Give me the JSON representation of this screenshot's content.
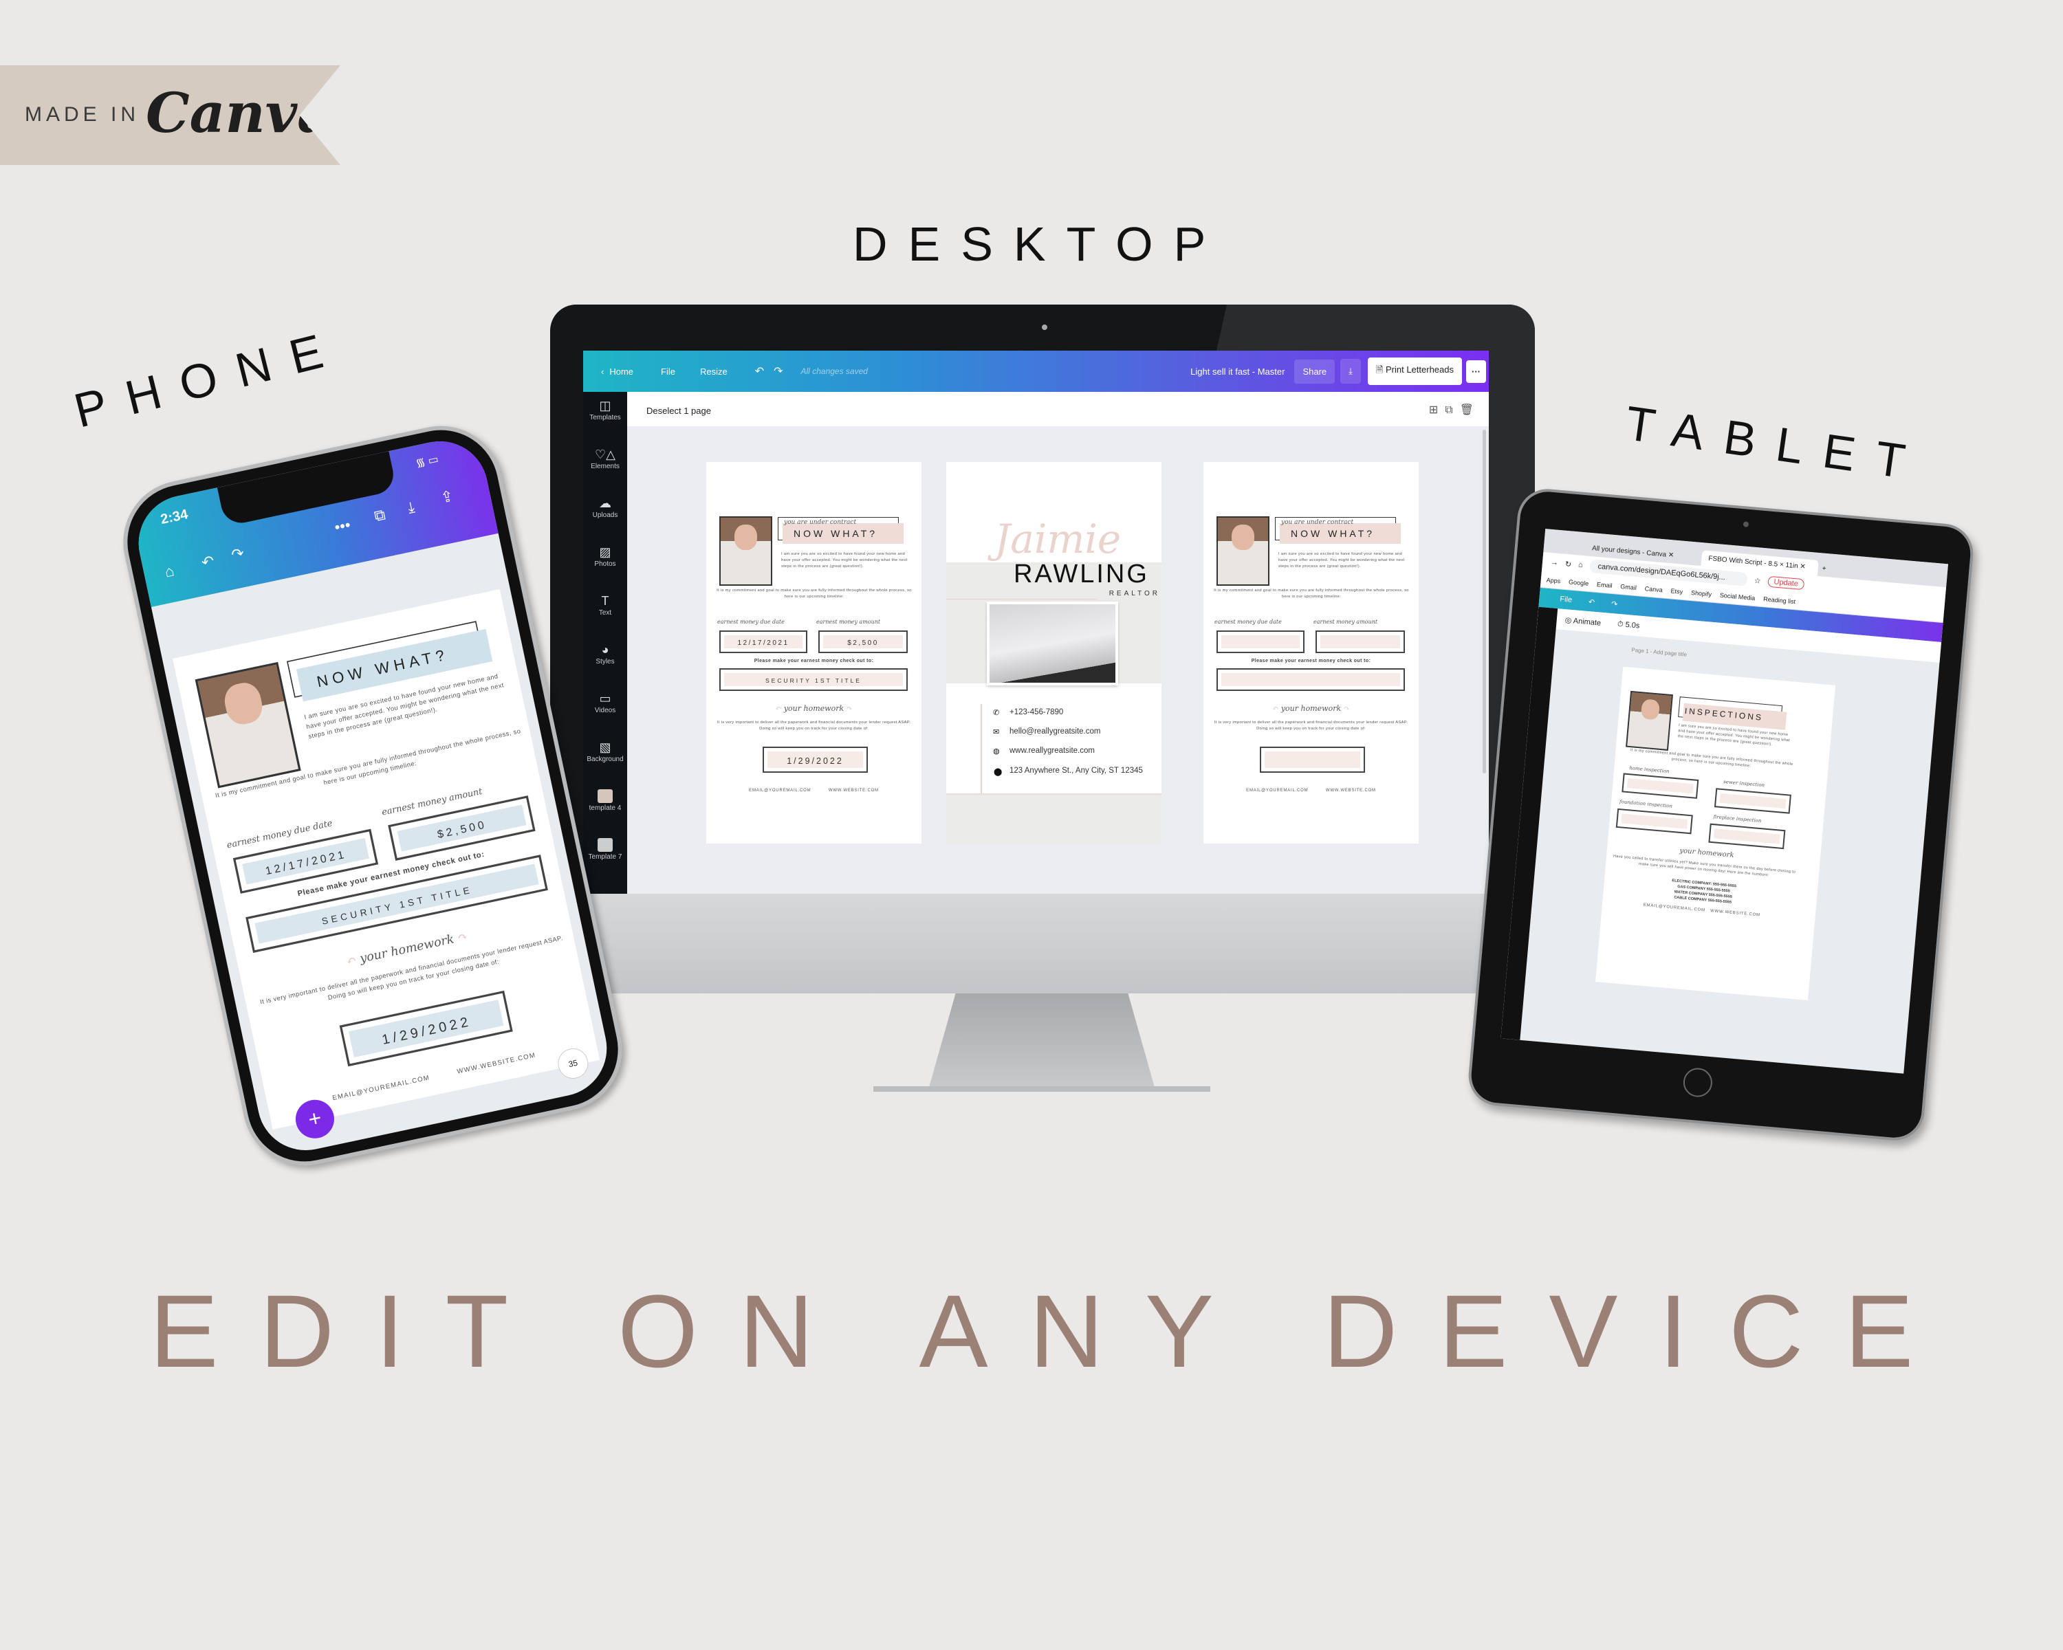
{
  "brand": {
    "made_in": "MADE IN",
    "logo": "Canva"
  },
  "headings": {
    "desktop": "DESKTOP",
    "phone": "PHONE",
    "tablet": "TABLET",
    "tagline": "EDIT ON ANY DEVICE"
  },
  "colors": {
    "accent_start": "#1fb5c6",
    "accent_end": "#7b2ff0",
    "tagline": "#9b8075",
    "blush": "#f0dcd6",
    "fab": "#7d2ae8"
  },
  "desktop": {
    "toolbar": {
      "home": "Home",
      "file": "File",
      "resize": "Resize",
      "status": "All changes saved",
      "doc_title": "Light sell it fast - Master",
      "share": "Share",
      "print": "Print Letterheads",
      "more": "···"
    },
    "sidebar": [
      {
        "label": "Templates",
        "icon": "templates-icon"
      },
      {
        "label": "Elements",
        "icon": "elements-icon"
      },
      {
        "label": "Uploads",
        "icon": "upload-cloud-icon"
      },
      {
        "label": "Photos",
        "icon": "photos-icon"
      },
      {
        "label": "Text",
        "icon": "text-icon"
      },
      {
        "label": "Styles",
        "icon": "palette-icon"
      },
      {
        "label": "Videos",
        "icon": "video-icon"
      },
      {
        "label": "Background",
        "icon": "background-icon"
      },
      {
        "label": "template 4",
        "icon": "template-thumbnail"
      },
      {
        "label": "Template 7",
        "icon": "template-thumbnail"
      }
    ],
    "deselect": "Deselect 1 page"
  },
  "letter": {
    "script_title": "you are under contract",
    "title": "NOW WHAT?",
    "para1": "I am sure you are so excited to have found your new home and have your offer accepted.  You might be wondering what the next steps in the process are (great question!).",
    "para2": "It is my commitment and goal to make sure you are fully informed throughout the whole process, so here is our upcoming timeline:",
    "label1": "earnest money due date",
    "label2": "earnest money amount",
    "value1": "12/17/2021",
    "value2": "$2,500",
    "checkout": "Please make your earnest money check out to:",
    "title_co": "SECURITY 1ST TITLE",
    "homework": "your homework",
    "para3": "It is very important to deliver all the paperwork and financial documents your lender request ASAP.  Doing so will keep you on track for your closing date of:",
    "closing": "1/29/2022",
    "email": "EMAIL@YOUREMAIL.COM",
    "website": "WWW.WEBSITE.COM"
  },
  "card": {
    "first": "Jaimie",
    "last": "RAWLING",
    "role": "REALTOR",
    "phone": "+123-456-7890",
    "email": "hello@reallygreatsite.com",
    "web": "www.reallygreatsite.com",
    "address": "123 Anywhere St., Any City, ST 12345"
  },
  "phone_ui": {
    "time": "2:34",
    "page_badge": "35",
    "fab": "+"
  },
  "tablet_ui": {
    "tab1": "All your designs - Canva",
    "tab2": "FSBO With Script - 8.5 × 11in",
    "url": "canva.com/design/DAEqGo6L56k/9j...",
    "bookmarks": [
      "Apps",
      "Google",
      "Email",
      "Gmail",
      "Canva",
      "Etsy",
      "Shopify",
      "Social Media",
      "Reading list"
    ],
    "update": "Update",
    "file": "File",
    "animate": "Animate",
    "duration": "5.0s",
    "page_title": "Page 1 - Add page title",
    "doc": {
      "script_title": "your upcoming",
      "title": "INSPECTIONS",
      "para1": "I am sure you are so excited to have found your new home and have your offer accepted.  You might be wondering what the next steps in the process are (great question!).",
      "para2": "It is my commitment and goal to make sure you are fully informed throughout the whole process, so here is our upcoming timeline:",
      "l1": "home inspection",
      "l2": "sewer inspection",
      "l3": "foundation inspection",
      "l4": "fireplace inspection",
      "homework": "your homework",
      "para3": "Have you called to transfer utilities yet?  Make sure you transfer them on the day before closing to make sure you will have power on moving day! Here are the numbers:",
      "u1": "ELECTRIC COMPANY: 555-555-5555",
      "u2": "GAS COMPANY 555-555-5555",
      "u3": "WATER COMPANY 555-555-5555",
      "u4": "CABLE COMPANY 555-555-5555",
      "email": "EMAIL@YOUREMAIL.COM",
      "website": "WWW.WEBSITE.COM"
    }
  }
}
